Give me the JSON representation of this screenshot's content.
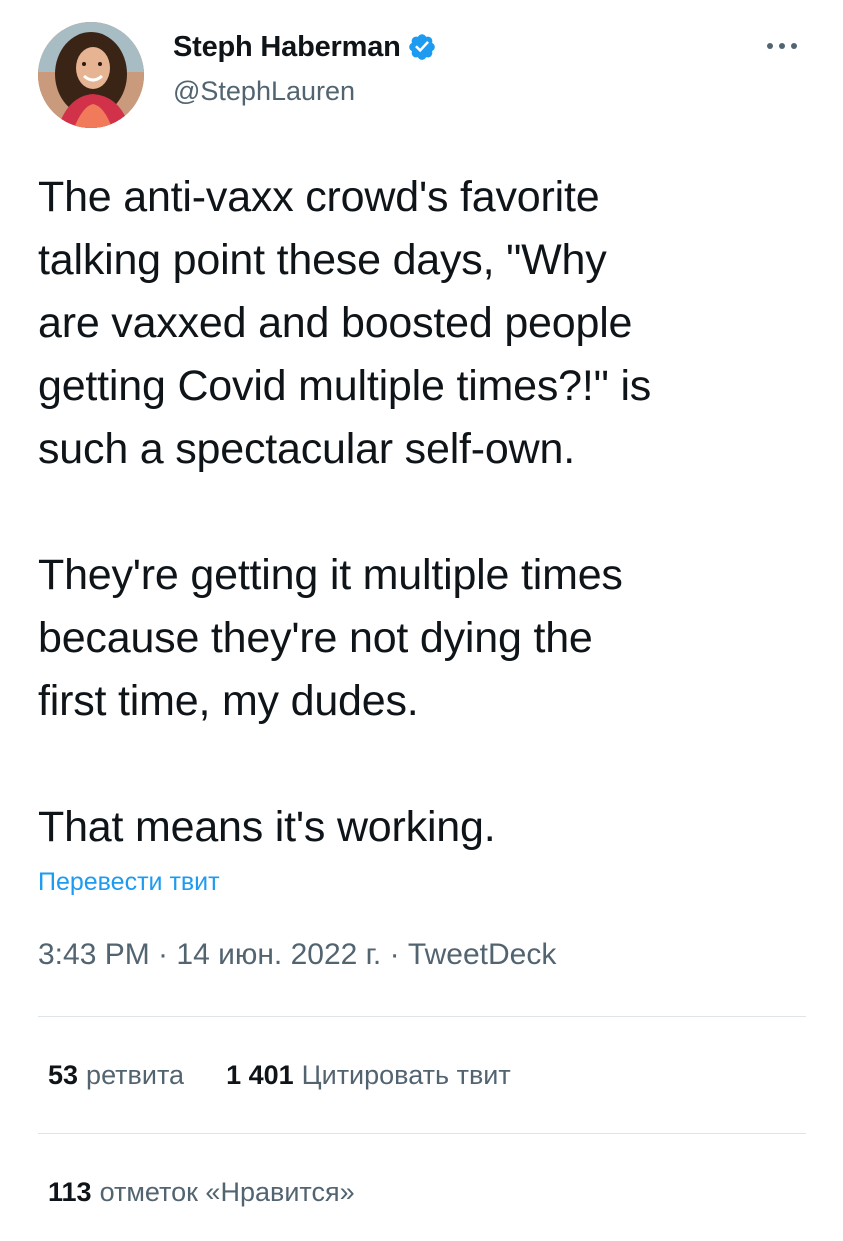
{
  "user": {
    "display_name": "Steph Haberman",
    "handle": "@StephLauren",
    "verified": true
  },
  "tweet": {
    "text": "The anti-vaxx crowd's favorite\ntalking point these days, \"Why\nare vaxxed and boosted people\ngetting Covid multiple times?!\" is\nsuch a spectacular self-own.\n\nThey're getting it multiple times\nbecause they're not dying the\nfirst time, my dudes.\n\nThat means it's working.",
    "translate_label": "Перевести твит",
    "timestamp": "3:43 PM · 14 июн. 2022 г. · TweetDeck"
  },
  "stats": {
    "retweets_count": "53",
    "retweets_label": "ретвита",
    "quotes_count": "1 401",
    "quotes_label": "Цитировать твит",
    "likes_count": "113",
    "likes_label": "отметок «Нравится»"
  },
  "colors": {
    "accent": "#1d9bf0",
    "secondary_text": "#536471",
    "primary_text": "#0f1419",
    "divider": "#dfe4e8"
  },
  "icons": {
    "verified": "verified-badge-icon",
    "more": "more-options-icon"
  }
}
